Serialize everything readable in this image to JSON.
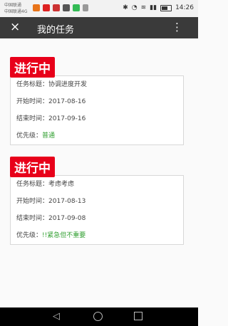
{
  "status": {
    "carrier1": "中国联通",
    "carrier2": "中国联通4G",
    "time": "14:26"
  },
  "header": {
    "back_icon": "×",
    "title": "我的任务",
    "more_icon": "⋮"
  },
  "tasks": [
    {
      "status_label": "进行中",
      "title_label": "任务标题：",
      "title_value": "协调进度开发",
      "start_label": "开始时间：",
      "start_value": "2017-08-16",
      "end_label": "结束时间：",
      "end_value": "2017-09-16",
      "priority_label": "优先级：",
      "priority_value": "普通"
    },
    {
      "status_label": "进行中",
      "title_label": "任务标题：",
      "title_value": "考虑考虑",
      "start_label": "开始时间：",
      "start_value": "2017-08-13",
      "end_label": "结束时间：",
      "end_value": "2017-09-08",
      "priority_label": "优先级：",
      "priority_value": "!!紧急但不重要"
    }
  ],
  "nav": {
    "back": "◁"
  }
}
